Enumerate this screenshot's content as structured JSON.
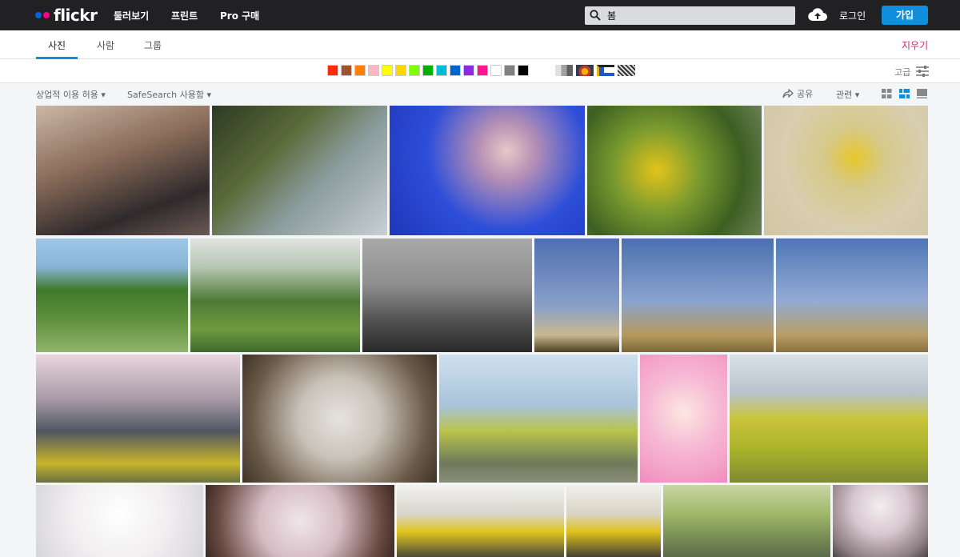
{
  "header": {
    "logo_text": "flickr",
    "nav": [
      "둘러보기",
      "프린트",
      "Pro 구매"
    ],
    "search_value": "봄",
    "login_label": "로그인",
    "signup_label": "가입"
  },
  "tabs": {
    "items": [
      "사진",
      "사람",
      "그룹"
    ],
    "active": "사진",
    "clear_label": "지우기"
  },
  "color_filter": {
    "swatches": [
      "#ff2a00",
      "#a0522d",
      "#ff7f00",
      "#ffb6c1",
      "#ffff00",
      "#ffd700",
      "#7fff00",
      "#00b200",
      "#00bcd4",
      "#0066cc",
      "#8a2be2",
      "#ff1493",
      "#ffffff",
      "#808080",
      "#000000"
    ],
    "advanced_label": "고급"
  },
  "toolbar": {
    "license_label": "상업적 이용 허용",
    "safesearch_label": "SafeSearch 사용함",
    "share_label": "공유",
    "sort_label": "관련"
  },
  "photos": [
    {
      "name": "photo-cafe-interior",
      "bg": "linear-gradient(160deg,#cbb7a6 0%,#8a6c5a 40%,#2f2a2c 75%,#6b5a55 100%)"
    },
    {
      "name": "photo-plants-balcony",
      "bg": "linear-gradient(135deg,#2d3a24 0%,#5a6b3a 35%,#8a9a9a 60%,#c8d0d4 100%)"
    },
    {
      "name": "photo-cherry-blossom-night",
      "bg": "radial-gradient(circle at 60% 35%,#e9c8c8 0%,#b58fb5 20%,#2d4ed9 55%,#1f36b8 100%)"
    },
    {
      "name": "photo-forsythia-bush",
      "bg": "radial-gradient(circle at 40% 50%,#e3c41a 0%,#7a9a2f 35%,#3c5f22 70%,#6b7f55 100%)"
    },
    {
      "name": "photo-forsythia-branch",
      "bg": "radial-gradient(circle at 55% 40%,#e6c72b 0%,#d6c98a 25%,#d8ceb0 60%,#cfc6a2 100%)"
    },
    {
      "name": "photo-mountain-village",
      "bg": "linear-gradient(180deg,#9ec8ea 0%,#8ab4d6 25%,#3f7a2c 45%,#5e8f3a 70%,#8fb36a 100%)"
    },
    {
      "name": "photo-green-tea-field",
      "bg": "linear-gradient(180deg,#dfe3df 0%,#b8c6b4 25%,#4f7a36 55%,#6f9a40 80%,#3f6a2a 100%)"
    },
    {
      "name": "photo-paraglider-bw",
      "bg": "linear-gradient(180deg,#a8a8a8 0%,#8f8f8f 40%,#4d4d4d 75%,#2a2a2a 100%)"
    },
    {
      "name": "photo-pine-sky-1",
      "bg": "linear-gradient(180deg,#4e6fb2 0%,#8aa0c8 60%,#c8b890 85%,#4b3f20 100%)"
    },
    {
      "name": "photo-pine-sky-2",
      "bg": "linear-gradient(180deg,#4a6fb0 0%,#8aa3cf 55%,#b59a5c 85%,#7a6638 100%)"
    },
    {
      "name": "photo-pine-sky-3",
      "bg": "linear-gradient(180deg,#4f76b8 0%,#93abd3 55%,#b79e64 85%,#8a7140 100%)"
    },
    {
      "name": "photo-cherry-forsythia-water",
      "bg": "linear-gradient(180deg,#e9d6de 0%,#a79aa6 35%,#505663 60%,#c8b52a 85%,#6a7040 100%)"
    },
    {
      "name": "photo-larch-trees-up",
      "bg": "radial-gradient(circle at 50% 50%,#e6e3df 0%,#c9c2b8 35%,#6b5a48 75%,#3e3328 100%)"
    },
    {
      "name": "photo-woman-field",
      "bg": "linear-gradient(180deg,#cfe0ee 0%,#a9c3da 40%,#b9c34a 60%,#6e7a5a 85%,#8b8e7a 100%)"
    },
    {
      "name": "photo-cartoon-girl",
      "bg": "radial-gradient(circle at 50% 45%,#fde7e0 0%,#f6b8d4 45%,#f4a2c9 75%,#ee8bbd 100%)"
    },
    {
      "name": "photo-woman-arms-open",
      "bg": "linear-gradient(180deg,#d9e1e6 0%,#b7c3cc 30%,#c9c43a 50%,#a9b22a 75%,#7d8a33 100%)"
    },
    {
      "name": "photo-rainbow-cake",
      "bg": "radial-gradient(circle at 50% 40%,#ffffff 0%,#f1eff0 50%,#d6d5da 100%)"
    },
    {
      "name": "photo-cherry-branches",
      "bg": "radial-gradient(circle at 50% 50%,#efe6ea 0%,#d6bcc4 40%,#6b4c44 80%,#3a2a24 100%)"
    },
    {
      "name": "photo-forsythia-man-1",
      "bg": "linear-gradient(180deg,#f1f1ee 0%,#d8d6cc 40%,#e1c51f 65%,#4c4c3a 100%)"
    },
    {
      "name": "photo-forsythia-man-2",
      "bg": "linear-gradient(180deg,#f0f0ec 0%,#d9d4c4 40%,#e0c11c 65%,#434032 100%)"
    },
    {
      "name": "photo-willow-trees",
      "bg": "linear-gradient(180deg,#c8d6a4 0%,#9fb86a 40%,#7a9156 70%,#5c6a4a 100%)"
    },
    {
      "name": "photo-cherry-street",
      "bg": "radial-gradient(circle at 50% 30%,#f3eef0 0%,#d8c8cf 40%,#8a7c80 80%,#4d4447 100%)"
    }
  ]
}
